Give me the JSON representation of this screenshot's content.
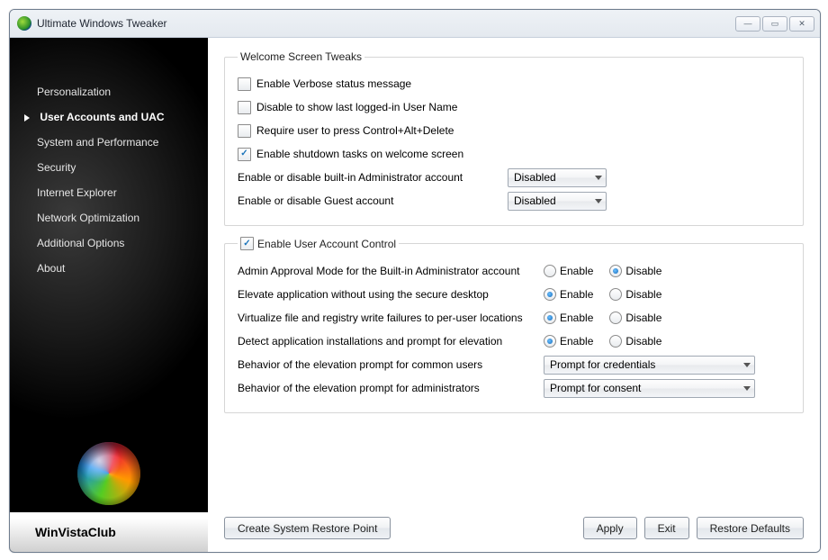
{
  "window": {
    "title": "Ultimate Windows Tweaker"
  },
  "sidebar": {
    "items": [
      {
        "label": "Personalization"
      },
      {
        "label": "User Accounts and UAC"
      },
      {
        "label": "System and Performance"
      },
      {
        "label": "Security"
      },
      {
        "label": "Internet Explorer"
      },
      {
        "label": "Network Optimization"
      },
      {
        "label": "Additional Options"
      },
      {
        "label": "About"
      }
    ],
    "selected_index": 1,
    "brand": "WinVistaClub"
  },
  "welcome": {
    "legend": "Welcome Screen Tweaks",
    "checks": [
      {
        "label": "Enable Verbose status message",
        "checked": false
      },
      {
        "label": "Disable to show last logged-in User Name",
        "checked": false
      },
      {
        "label": "Require user to press Control+Alt+Delete",
        "checked": false
      },
      {
        "label": "Enable shutdown tasks on welcome screen",
        "checked": true
      }
    ],
    "selects": [
      {
        "label": "Enable or disable built-in Administrator account",
        "value": "Disabled"
      },
      {
        "label": "Enable or disable Guest account",
        "value": "Disabled"
      }
    ]
  },
  "uac": {
    "legend": "Enable User Account Control",
    "legend_checked": true,
    "enable_label": "Enable",
    "disable_label": "Disable",
    "radios": [
      {
        "label": "Admin Approval Mode for the Built-in Administrator account",
        "value": "disable"
      },
      {
        "label": "Elevate application without using the secure desktop",
        "value": "enable"
      },
      {
        "label": "Virtualize file and registry write failures to per-user locations",
        "value": "enable"
      },
      {
        "label": "Detect application installations and prompt for elevation",
        "value": "enable"
      }
    ],
    "selects": [
      {
        "label": "Behavior of the elevation prompt for common users",
        "value": "Prompt for credentials"
      },
      {
        "label": "Behavior of the elevation prompt for administrators",
        "value": "Prompt for consent"
      }
    ]
  },
  "footer": {
    "restore_point": "Create System Restore Point",
    "apply": "Apply",
    "exit": "Exit",
    "defaults": "Restore Defaults"
  }
}
